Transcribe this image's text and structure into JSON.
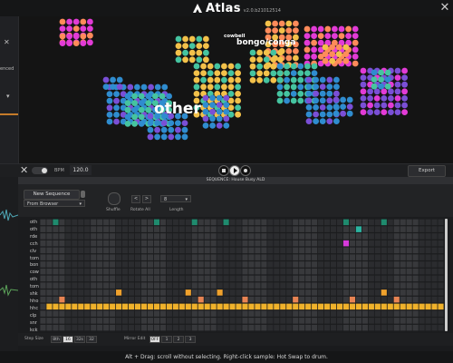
{
  "app": {
    "name": "Atlas",
    "version": "v2.0.b21012514",
    "status_text": "Alt + Drag: scroll without selecting. Right-click sample: Hot Swap to drum."
  },
  "left_panel": {
    "partial_text": "enced"
  },
  "map": {
    "labels": {
      "other": "other",
      "cowbell": "cowbell",
      "bongo": "bongo/conga"
    },
    "colors": [
      "#e23bd6",
      "#ff8b5a",
      "#f3c14a",
      "#45c4a0",
      "#2f8ccf",
      "#7a4fd6"
    ]
  },
  "transport": {
    "bpm_label": "BPM",
    "bpm": "120.0",
    "export_label": "Export"
  },
  "sequence": {
    "title": "SEQUENCE: House Busy ALD",
    "new_sequence_label": "New Sequence",
    "source": "From Browser",
    "shuffle_label": "Shuffle",
    "rotate_label": "Rotate All",
    "length_label": "Length",
    "length_value": "8",
    "rotate_left": "<",
    "rotate_right": ">"
  },
  "lanes": [
    {
      "label": "oth",
      "color": "#1f8b6e"
    },
    {
      "label": "oth",
      "color": "#2bb3a0"
    },
    {
      "label": "rde",
      "color": "#c433d3"
    },
    {
      "label": "cch",
      "color": "#d63adb"
    },
    {
      "label": "clv",
      "color": "#ff7a5c"
    },
    {
      "label": "tom",
      "color": "#4c8a45"
    },
    {
      "label": "bon",
      "color": "#c46a3b"
    },
    {
      "label": "cow",
      "color": "#3ea88a"
    },
    {
      "label": "oth",
      "color": "#3b8a40"
    },
    {
      "label": "tom",
      "color": "#6aa543"
    },
    {
      "label": "shk",
      "color": "#f0a22d"
    },
    {
      "label": "hho",
      "color": "#e88453"
    },
    {
      "label": "hhc",
      "color": "#f0b22b"
    },
    {
      "label": "clp",
      "color": "#4aa8d8"
    },
    {
      "label": "snr",
      "color": "#3b74c7"
    },
    {
      "label": "kck",
      "color": "#3a6aa6"
    }
  ],
  "pattern": [
    [
      0,
      0,
      1,
      0,
      0,
      0,
      0,
      0,
      0,
      0,
      0,
      0,
      0,
      0,
      0,
      0,
      0,
      0,
      1,
      0,
      0,
      0,
      0,
      0,
      1,
      0,
      0,
      0,
      0,
      1,
      0,
      0,
      0,
      0,
      0,
      0,
      0,
      0,
      0,
      0,
      0,
      0,
      0,
      0,
      0,
      0,
      0,
      0,
      1,
      0,
      0,
      0,
      0,
      0,
      1,
      0,
      0,
      0,
      0,
      0,
      0,
      0,
      0,
      0
    ],
    [
      0,
      0,
      0,
      0,
      0,
      0,
      0,
      0,
      0,
      0,
      0,
      0,
      0,
      0,
      0,
      0,
      0,
      0,
      0,
      0,
      0,
      0,
      0,
      0,
      0,
      0,
      0,
      0,
      0,
      0,
      0,
      0,
      0,
      0,
      0,
      0,
      0,
      0,
      0,
      0,
      0,
      0,
      0,
      0,
      0,
      0,
      0,
      0,
      0,
      0,
      1,
      0,
      0,
      0,
      0,
      0,
      0,
      0,
      0,
      0,
      0,
      0,
      0,
      0
    ],
    [
      0,
      0,
      0,
      0,
      0,
      0,
      0,
      0,
      0,
      0,
      0,
      0,
      0,
      0,
      0,
      0,
      0,
      0,
      0,
      0,
      0,
      0,
      0,
      0,
      0,
      0,
      0,
      0,
      0,
      0,
      0,
      0,
      0,
      0,
      0,
      0,
      0,
      0,
      0,
      0,
      0,
      0,
      0,
      0,
      0,
      0,
      0,
      0,
      0,
      0,
      0,
      0,
      0,
      0,
      0,
      0,
      0,
      0,
      0,
      0,
      0,
      0,
      0,
      0
    ],
    [
      0,
      0,
      0,
      0,
      0,
      0,
      0,
      0,
      0,
      0,
      0,
      0,
      0,
      0,
      0,
      0,
      0,
      0,
      0,
      0,
      0,
      0,
      0,
      0,
      0,
      0,
      0,
      0,
      0,
      0,
      0,
      0,
      0,
      0,
      0,
      0,
      0,
      0,
      0,
      0,
      0,
      0,
      0,
      0,
      0,
      0,
      0,
      0,
      1,
      0,
      0,
      0,
      0,
      0,
      0,
      0,
      0,
      0,
      0,
      0,
      0,
      0,
      0,
      0
    ],
    [
      0,
      0,
      0,
      0,
      0,
      0,
      0,
      0,
      0,
      0,
      0,
      0,
      0,
      0,
      0,
      0,
      0,
      0,
      0,
      0,
      0,
      0,
      0,
      0,
      0,
      0,
      0,
      0,
      0,
      0,
      0,
      0,
      0,
      0,
      0,
      0,
      0,
      0,
      0,
      0,
      0,
      0,
      0,
      0,
      0,
      0,
      0,
      0,
      0,
      0,
      0,
      0,
      0,
      0,
      0,
      0,
      0,
      0,
      0,
      0,
      0,
      0,
      0,
      0
    ],
    [
      0,
      0,
      0,
      0,
      0,
      0,
      0,
      0,
      0,
      0,
      0,
      0,
      0,
      0,
      0,
      0,
      0,
      0,
      0,
      0,
      0,
      0,
      0,
      0,
      0,
      0,
      0,
      0,
      0,
      0,
      0,
      0,
      0,
      0,
      0,
      0,
      0,
      0,
      0,
      0,
      0,
      0,
      0,
      0,
      0,
      0,
      0,
      0,
      0,
      0,
      0,
      0,
      0,
      0,
      0,
      0,
      0,
      0,
      0,
      0,
      0,
      0,
      0,
      0
    ],
    [
      0,
      0,
      0,
      0,
      0,
      0,
      0,
      0,
      0,
      0,
      0,
      0,
      0,
      0,
      0,
      0,
      0,
      0,
      0,
      0,
      0,
      0,
      0,
      0,
      0,
      0,
      0,
      0,
      0,
      0,
      0,
      0,
      0,
      0,
      0,
      0,
      0,
      0,
      0,
      0,
      0,
      0,
      0,
      0,
      0,
      0,
      0,
      0,
      0,
      0,
      0,
      0,
      0,
      0,
      0,
      0,
      0,
      0,
      0,
      0,
      0,
      0,
      0,
      0
    ],
    [
      0,
      0,
      0,
      0,
      0,
      0,
      0,
      0,
      0,
      0,
      0,
      0,
      0,
      0,
      0,
      0,
      0,
      0,
      0,
      0,
      0,
      0,
      0,
      0,
      0,
      0,
      0,
      0,
      0,
      0,
      0,
      0,
      0,
      0,
      0,
      0,
      0,
      0,
      0,
      0,
      0,
      0,
      0,
      0,
      0,
      0,
      0,
      0,
      0,
      0,
      0,
      0,
      0,
      0,
      0,
      0,
      0,
      0,
      0,
      0,
      0,
      0,
      0,
      0
    ],
    [
      0,
      0,
      0,
      0,
      0,
      0,
      0,
      0,
      0,
      0,
      0,
      0,
      0,
      0,
      0,
      0,
      0,
      0,
      0,
      0,
      0,
      0,
      0,
      0,
      0,
      0,
      0,
      0,
      0,
      0,
      0,
      0,
      0,
      0,
      0,
      0,
      0,
      0,
      0,
      0,
      0,
      0,
      0,
      0,
      0,
      0,
      0,
      0,
      0,
      0,
      0,
      0,
      0,
      0,
      0,
      0,
      0,
      0,
      0,
      0,
      0,
      0,
      0,
      0
    ],
    [
      0,
      0,
      0,
      0,
      0,
      0,
      0,
      0,
      0,
      0,
      0,
      0,
      0,
      0,
      0,
      0,
      0,
      0,
      0,
      0,
      0,
      0,
      0,
      0,
      0,
      0,
      0,
      0,
      0,
      0,
      0,
      0,
      0,
      0,
      0,
      0,
      0,
      0,
      0,
      0,
      0,
      0,
      0,
      0,
      0,
      0,
      0,
      0,
      0,
      0,
      0,
      0,
      0,
      0,
      0,
      0,
      0,
      0,
      0,
      0,
      0,
      0,
      0,
      0
    ],
    [
      0,
      0,
      0,
      0,
      0,
      0,
      0,
      0,
      0,
      0,
      0,
      0,
      1,
      0,
      0,
      0,
      0,
      0,
      0,
      0,
      0,
      0,
      0,
      1,
      0,
      0,
      0,
      0,
      1,
      0,
      0,
      0,
      0,
      0,
      0,
      0,
      0,
      0,
      0,
      0,
      0,
      0,
      0,
      0,
      0,
      0,
      0,
      0,
      0,
      0,
      0,
      0,
      0,
      0,
      1,
      0,
      0,
      0,
      0,
      0,
      0,
      0,
      0,
      0
    ],
    [
      0,
      0,
      0,
      1,
      0,
      0,
      0,
      0,
      0,
      0,
      0,
      0,
      0,
      0,
      0,
      0,
      0,
      0,
      0,
      0,
      0,
      0,
      0,
      0,
      0,
      1,
      0,
      0,
      0,
      0,
      0,
      0,
      1,
      0,
      0,
      0,
      0,
      0,
      0,
      0,
      1,
      0,
      0,
      0,
      0,
      0,
      0,
      0,
      0,
      1,
      0,
      0,
      0,
      0,
      0,
      0,
      1,
      0,
      0,
      0,
      0,
      0,
      0,
      0
    ],
    [
      0,
      1,
      1,
      1,
      1,
      1,
      1,
      1,
      1,
      1,
      1,
      1,
      1,
      1,
      1,
      1,
      1,
      1,
      1,
      1,
      1,
      1,
      1,
      1,
      1,
      1,
      1,
      1,
      1,
      1,
      1,
      1,
      1,
      1,
      1,
      1,
      1,
      1,
      1,
      1,
      1,
      1,
      1,
      1,
      1,
      1,
      1,
      1,
      1,
      1,
      1,
      1,
      1,
      1,
      1,
      1,
      1,
      1,
      1,
      1,
      1,
      1,
      1,
      1
    ],
    [
      0,
      0,
      0,
      0,
      0,
      0,
      0,
      0,
      0,
      0,
      0,
      0,
      0,
      0,
      0,
      0,
      0,
      0,
      0,
      0,
      0,
      0,
      0,
      0,
      0,
      0,
      0,
      0,
      0,
      0,
      0,
      0,
      0,
      0,
      0,
      0,
      0,
      0,
      0,
      0,
      0,
      0,
      0,
      0,
      0,
      0,
      0,
      0,
      0,
      0,
      0,
      0,
      0,
      0,
      0,
      0,
      0,
      0,
      0,
      0,
      0,
      0,
      0,
      0
    ],
    [
      0,
      0,
      0,
      0,
      0,
      0,
      0,
      0,
      0,
      0,
      0,
      0,
      0,
      0,
      0,
      0,
      0,
      0,
      0,
      0,
      0,
      0,
      0,
      0,
      0,
      0,
      0,
      0,
      0,
      0,
      0,
      0,
      0,
      0,
      0,
      0,
      0,
      0,
      0,
      0,
      0,
      0,
      0,
      0,
      0,
      0,
      0,
      0,
      0,
      0,
      0,
      0,
      0,
      0,
      0,
      0,
      0,
      0,
      0,
      0,
      0,
      0,
      0,
      0
    ],
    [
      0,
      0,
      0,
      0,
      0,
      0,
      0,
      0,
      0,
      0,
      0,
      0,
      0,
      0,
      0,
      0,
      0,
      0,
      0,
      0,
      0,
      0,
      0,
      0,
      0,
      0,
      0,
      0,
      0,
      0,
      0,
      0,
      0,
      0,
      0,
      0,
      0,
      0,
      0,
      0,
      0,
      0,
      0,
      0,
      0,
      0,
      0,
      0,
      0,
      0,
      0,
      0,
      0,
      0,
      0,
      0,
      0,
      0,
      0,
      0,
      0,
      0,
      0,
      0
    ]
  ],
  "bottom": {
    "step_size_label": "Step Size",
    "step_options": [
      "8th",
      "16",
      "32s",
      "32"
    ],
    "mirror_label": "Mirror Edit",
    "mirror_options": [
      "OFF",
      "1",
      "2",
      "3"
    ]
  }
}
